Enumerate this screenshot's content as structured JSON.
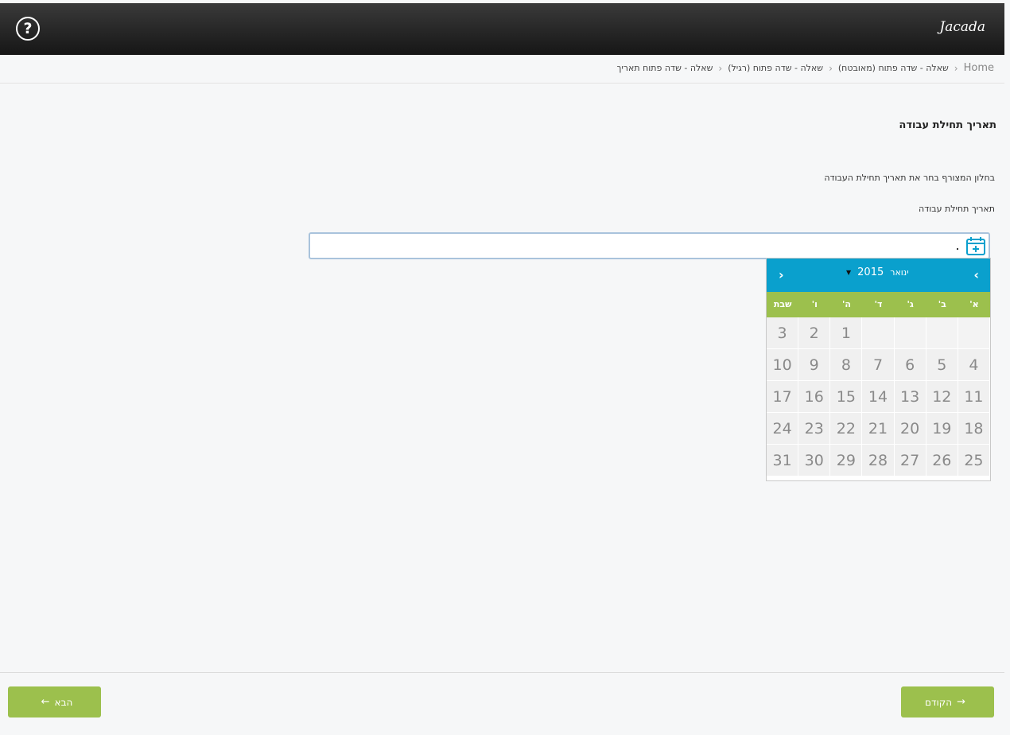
{
  "header": {
    "help_icon": "help-circle-icon",
    "help_glyph": "?",
    "logo_text": "Jacada"
  },
  "breadcrumb": {
    "items": [
      "Home",
      "שאלה - שדה פתוח (מאובטח)",
      "שאלה - שדה פתוח (רגיל)",
      "שאלה - שדה פתוח תאריך"
    ]
  },
  "question": {
    "title": "תאריך תחילת עבודה",
    "description": "בחלון המצורף בחר את תאריך תחילת העבודה",
    "field_label": "תאריך תחילת עבודה",
    "input_value": ""
  },
  "calendar": {
    "prev_glyph": "‹",
    "next_glyph": "›",
    "month": "ינואר",
    "year": "2015",
    "dropdown_glyph": "▼",
    "weekdays": [
      "א'",
      "ב'",
      "ג'",
      "ד'",
      "ה'",
      "ו'",
      "שבת"
    ],
    "weeks": [
      [
        "",
        "",
        "",
        "",
        "1",
        "2",
        "3"
      ],
      [
        "4",
        "5",
        "6",
        "7",
        "8",
        "9",
        "10"
      ],
      [
        "11",
        "12",
        "13",
        "14",
        "15",
        "16",
        "17"
      ],
      [
        "18",
        "19",
        "20",
        "21",
        "22",
        "23",
        "24"
      ],
      [
        "25",
        "26",
        "27",
        "28",
        "29",
        "30",
        "31"
      ]
    ]
  },
  "footer": {
    "prev_label": "הקודם",
    "prev_arrow": "→",
    "next_label": "הבא",
    "next_arrow": "←"
  },
  "colors": {
    "calendar_header": "#0aa0cd",
    "weekday_bar": "#9cc04d",
    "button": "#9cc04d",
    "topbar": "#222222"
  }
}
